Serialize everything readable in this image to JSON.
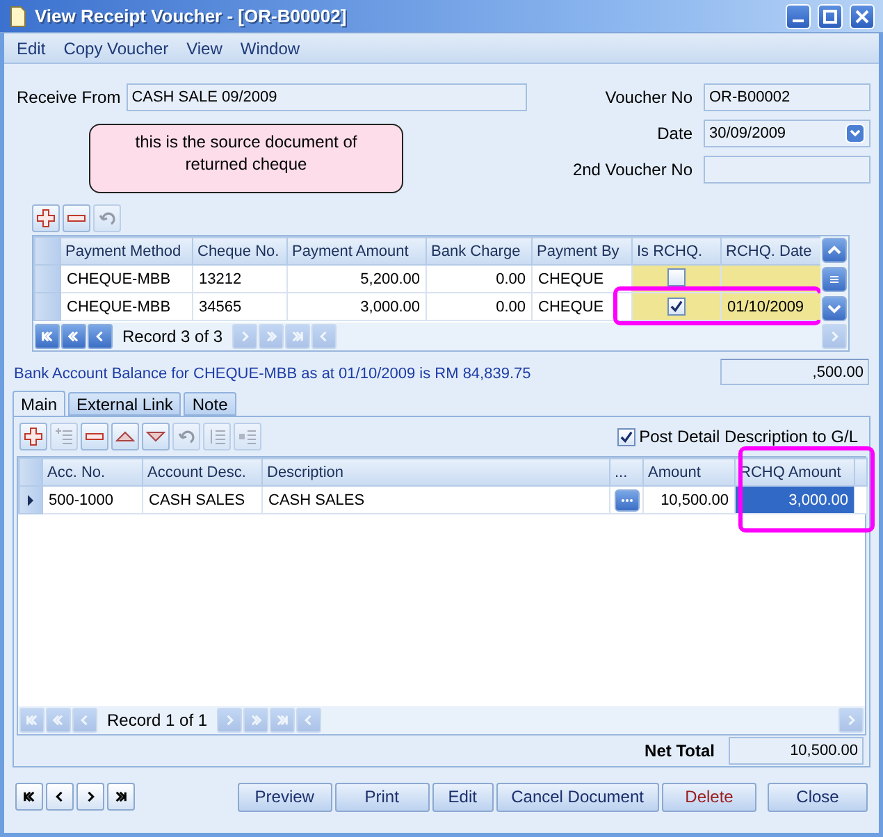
{
  "window": {
    "title": "View Receipt Voucher - [OR-B00002]"
  },
  "menu": [
    "Edit",
    "Copy Voucher",
    "View",
    "Window"
  ],
  "header": {
    "receive_from": {
      "label": "Receive From",
      "value": "CASH SALE 09/2009"
    },
    "voucher_no": {
      "label": "Voucher No",
      "value": "OR-B00002"
    },
    "date": {
      "label": "Date",
      "value": "30/09/2009"
    },
    "second_voucher_no": {
      "label": "2nd Voucher No"
    }
  },
  "note": "this is the source document of returned cheque",
  "cheque_toolbar": [
    {
      "kind": "add",
      "disabled": false
    },
    {
      "kind": "remove",
      "disabled": false
    },
    {
      "kind": "undo",
      "disabled": true
    }
  ],
  "cheque_table": {
    "columns": [
      "Payment Method",
      "Cheque No.",
      "Payment Amount",
      "Bank Charge",
      "Payment By",
      "Is RCHQ.",
      "RCHQ. Date"
    ],
    "rows": [
      {
        "payment_method": "CHEQUE-MBB",
        "cheque_no": "13212",
        "payment_amount": "5,200.00",
        "bank_charge": "0.00",
        "payment_by": "CHEQUE",
        "is_rchq": false,
        "annotated": false
      },
      {
        "payment_method": "CHEQUE-MBB",
        "cheque_no": "34565",
        "payment_amount": "3,000.00",
        "bank_charge": "0.00",
        "payment_by": "CHEQUE",
        "is_rchq": true,
        "rchq_date": "01/10/2009",
        "annotated": true
      }
    ],
    "navigator": {
      "record": "Record 3 of 3",
      "buttons": [
        {
          "kind": "first",
          "disabled": false
        },
        {
          "kind": "prev-page",
          "disabled": false
        },
        {
          "kind": "prev",
          "disabled": false
        },
        {
          "kind": "next",
          "disabled": true
        },
        {
          "kind": "next-page",
          "disabled": true
        },
        {
          "kind": "last",
          "disabled": true
        }
      ]
    }
  },
  "balance_text": "Bank Account Balance for CHEQUE-MBB as at 01/10/2009 is RM 84,839.75",
  "balance_amount": ",500.00",
  "tabs": [
    {
      "label": "Main",
      "selected": true
    },
    {
      "label": "External Link",
      "selected": false
    },
    {
      "label": "Note",
      "selected": false
    }
  ],
  "detail_toolbar": [
    {
      "kind": "add",
      "disabled": false
    },
    {
      "kind": "insert",
      "disabled": true
    },
    {
      "kind": "remove",
      "disabled": false
    },
    {
      "kind": "up",
      "disabled": false
    },
    {
      "kind": "down",
      "disabled": false
    },
    {
      "kind": "undo",
      "disabled": true
    },
    {
      "kind": "indent",
      "disabled": true
    },
    {
      "kind": "outdent",
      "disabled": true
    }
  ],
  "post_detail": {
    "label": "Post Detail Description to G/L",
    "checked": true
  },
  "detail_table": {
    "columns": [
      "Acc. No.",
      "Account Desc.",
      "Description",
      "...",
      "Amount",
      "RCHQ Amount"
    ],
    "rows": [
      {
        "acc_no": "500-1000",
        "account_desc": "CASH SALES",
        "description": "CASH SALES",
        "amount": "10,500.00",
        "rchq_amount": "3,000.00",
        "current": true,
        "annotated": true
      }
    ],
    "navigator": {
      "record": "Record 1 of 1",
      "buttons": [
        {
          "kind": "first",
          "disabled": true
        },
        {
          "kind": "prev-page",
          "disabled": true
        },
        {
          "kind": "prev",
          "disabled": true
        },
        {
          "kind": "next",
          "disabled": true
        },
        {
          "kind": "next-page",
          "disabled": true
        },
        {
          "kind": "last",
          "disabled": true
        }
      ]
    }
  },
  "net_total": {
    "label": "Net Total",
    "value": "10,500.00"
  },
  "buttons": [
    {
      "label": "Preview",
      "kind": "normal"
    },
    {
      "label": "Print",
      "kind": "normal"
    },
    {
      "label": "Edit",
      "kind": "normal"
    },
    {
      "label": "Cancel Document",
      "kind": "normal"
    },
    {
      "label": "Delete",
      "kind": "danger"
    },
    {
      "label": "Close",
      "kind": "normal"
    }
  ]
}
